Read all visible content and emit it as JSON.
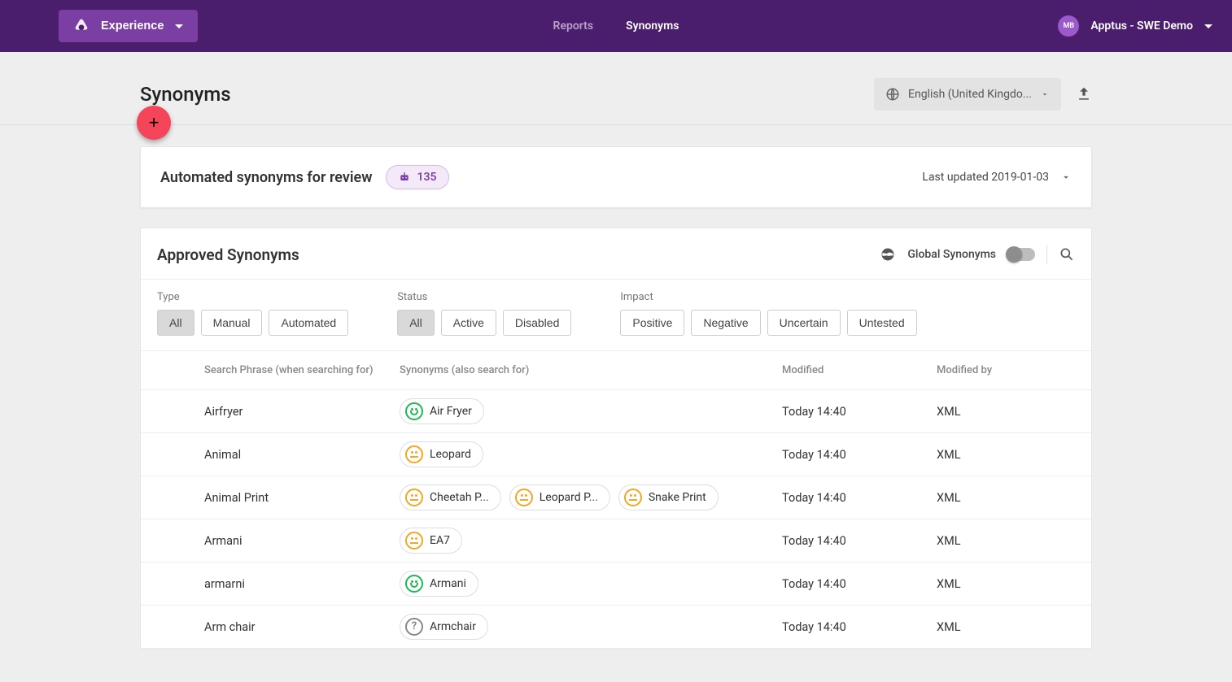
{
  "topbar": {
    "experience_label": "Experience",
    "nav": {
      "reports": "Reports",
      "synonyms": "Synonyms"
    },
    "avatar_initials": "MB",
    "org": "Apptus - SWE Demo"
  },
  "header": {
    "title": "Synonyms",
    "language": "English (United Kingdo..."
  },
  "review": {
    "title": "Automated synonyms for review",
    "count": "135",
    "updated": "Last updated 2019-01-03"
  },
  "approved": {
    "title": "Approved Synonyms",
    "global_label": "Global Synonyms"
  },
  "filters": {
    "type_label": "Type",
    "type_opts": [
      "All",
      "Manual",
      "Automated"
    ],
    "status_label": "Status",
    "status_opts": [
      "All",
      "Active",
      "Disabled"
    ],
    "impact_label": "Impact",
    "impact_opts": [
      "Positive",
      "Negative",
      "Uncertain",
      "Untested"
    ]
  },
  "table": {
    "cols": {
      "phrase": "Search Phrase (when searching for)",
      "syn": "Synonyms (also search for)",
      "modified": "Modified",
      "by": "Modified by"
    },
    "rows": [
      {
        "phrase": "Airfryer",
        "syns": [
          {
            "t": "Air Fryer",
            "face": "green"
          }
        ],
        "mod": "Today 14:40",
        "by": "XML"
      },
      {
        "phrase": "Animal",
        "syns": [
          {
            "t": "Leopard",
            "face": "orange"
          }
        ],
        "mod": "Today 14:40",
        "by": "XML"
      },
      {
        "phrase": "Animal Print",
        "syns": [
          {
            "t": "Cheetah P...",
            "face": "orange"
          },
          {
            "t": "Leopard P...",
            "face": "orange"
          },
          {
            "t": "Snake Print",
            "face": "orange"
          }
        ],
        "mod": "Today 14:40",
        "by": "XML"
      },
      {
        "phrase": "Armani",
        "syns": [
          {
            "t": "EA7",
            "face": "orange"
          }
        ],
        "mod": "Today 14:40",
        "by": "XML"
      },
      {
        "phrase": "armarni",
        "syns": [
          {
            "t": "Armani",
            "face": "green"
          }
        ],
        "mod": "Today 14:40",
        "by": "XML"
      },
      {
        "phrase": "Arm chair",
        "syns": [
          {
            "t": "Armchair",
            "face": "gray"
          }
        ],
        "mod": "Today 14:40",
        "by": "XML"
      }
    ]
  }
}
